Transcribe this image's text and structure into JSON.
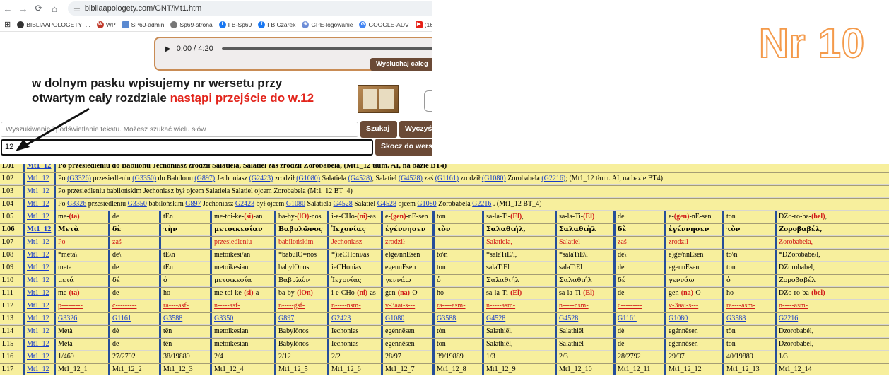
{
  "browser": {
    "url": "bibliaapologety.com/GNT/Mt1.htm",
    "bookmarks": [
      "BIBLIAAPOLOGETY_...",
      "WP",
      "SP69-admin",
      "Sp69-strona",
      "FB-Sp69",
      "FB Czarek",
      "GPE-logowanie",
      "GOOGLE-ADV",
      "(16"
    ]
  },
  "player": {
    "time": "0:00 / 4:20",
    "listen_label": "Wysłuchaj całeg"
  },
  "annotation": {
    "line1": "w dolnym pasku wpisujemy nr wersetu przy",
    "line2": "otwartym cały rozdziale",
    "line2_red": "nastąpi przejście do w.12"
  },
  "search": {
    "placeholder": "Wyszukiwanie i podświetlanie tekstu. Możesz szukać wielu słów",
    "search_label": "Szukaj",
    "clear_label": "Wyczyść",
    "verse_value": "12",
    "goto_label": "Skocz do wersetu"
  },
  "overlay": {
    "label": "Nr 10"
  },
  "table": {
    "L01": {
      "label": "L01",
      "ref": "Mt1_12",
      "text": "Po przesiedleniu do Babilonu Jechoniasz zrodził Salatiela, Salatiel zaś zrodził Zorobabela, (Mt1_12 tłum. AI, na bazie BT4)"
    },
    "L02": {
      "label": "L02",
      "ref": "Mt1_12",
      "parts": [
        "Po ",
        "(G3326)",
        " przesiedleniu ",
        "(G3350)",
        " do Babilonu ",
        "(G897)",
        " Jechoniasz ",
        "(G2423)",
        " zrodził ",
        "(G1080)",
        " Salatiela ",
        "(G4528)",
        ", Salatiel ",
        "(G4528)",
        " zaś ",
        "(G1161)",
        " zrodził ",
        "(G1080)",
        " Zorobabela ",
        "(G2216)",
        "; (Mt1_12 tłum. AI, na bazie BT4)"
      ]
    },
    "L03": {
      "label": "L03",
      "ref": "Mt1_12",
      "text": "Po przesiedleniu babilońskim Jechoniasz był ojcem Salatiela Salatiel ojcem Zorobabela (Mt1_12 BT_4)"
    },
    "L04": {
      "label": "L04",
      "ref": "Mt1_12",
      "parts": [
        "Po ",
        "G3326",
        " przesiedleniu ",
        "G3350",
        " babilońskim ",
        "G897",
        " Jechoniasz ",
        "G2423",
        " był ojcem ",
        "G1080",
        " Salatiela ",
        "G4528",
        " Salatiel ",
        "G4528",
        " ojcem ",
        "G1080",
        " Zorobabela ",
        "G2216",
        " . (Mt1_12 BT_4)"
      ]
    },
    "grid_rows": [
      {
        "label": "L05",
        "ref": "Mt1_12",
        "cells": [
          "me-(ta)",
          "de",
          "tEn",
          "me-toi-ke-(si)-an",
          "ba-by-(lO)-nos",
          "i-e-CHo-(ni)-as",
          "e-(gen)-nE-sen",
          "ton",
          "sa-la-Ti-(El),",
          "sa-la-Ti-(El)",
          "de",
          "e-(gen)-nE-sen",
          "ton",
          "DZo-ro-ba-(bel),"
        ]
      },
      {
        "label": "L06",
        "ref": "Mt1_12",
        "cells": [
          "Μετὰ",
          "δὲ",
          "τὴν",
          "μετοικεσίαν",
          "Βαβυλῶνος",
          "Ἰεχονίας",
          "ἐγέννησεν",
          "τὸν",
          "Σαλαθιήλ,",
          "Σαλαθιὴλ",
          "δὲ",
          "ἐγέννησεν",
          "τὸν",
          "Ζοροβαβέλ,"
        ]
      },
      {
        "label": "L07",
        "ref": "Mt1_12",
        "cells": [
          "Po",
          "zaś",
          "—",
          "przesiedleniu",
          "babilońskim",
          "Jechoniasz",
          "zrodził",
          "—",
          "Salatiela,",
          "Salatiel",
          "zaś",
          "zrodził",
          "—",
          "Zorobabela,"
        ]
      },
      {
        "label": "L08",
        "ref": "Mt1_12",
        "cells": [
          "*meta\\",
          "de\\",
          "tE\\n",
          "metoikesi/an",
          "*babulO=nos",
          "*)ieCHoni/as",
          "e)ge/nnEsen",
          "to\\n",
          "*salaTiE/l,",
          "*salaTiE\\l",
          "de\\",
          "e)ge/nnEsen",
          "to\\n",
          "*DZorobabe/l,"
        ]
      },
      {
        "label": "L09",
        "ref": "Mt1_12",
        "cells": [
          "meta",
          "de",
          "tEn",
          "metoikesian",
          "babylOnos",
          "ieCHonias",
          "egennEsen",
          "ton",
          "salaTiEl",
          "salaTiEl",
          "de",
          "egennEsen",
          "ton",
          "DZorobabel,"
        ]
      },
      {
        "label": "L10",
        "ref": "Mt1_12",
        "cells": [
          "μετά",
          "δέ",
          "ὁ",
          "μετοικεσία",
          "Βαβυλών",
          "Ἰεχονίας",
          "γεννάω",
          "ὁ",
          "Σαλαθιήλ",
          "Σαλαθιήλ",
          "δέ",
          "γεννάω",
          "ὁ",
          "Ζοροβαβέλ"
        ]
      },
      {
        "label": "L11",
        "ref": "Mt1_12",
        "cells": [
          "me-(ta)",
          "de",
          "ho",
          "me-toi-ke-(si)-a",
          "ba-by-(lOn)",
          "i-e-CHo-(ni)-as",
          "gen-(na)-O",
          "ho",
          "sa-la-Ti-(El)",
          "sa-la-Ti-(El)",
          "de",
          "gen-(na)-O",
          "ho",
          "DZo-ro-ba-(bel)"
        ]
      },
      {
        "label": "L12",
        "ref": "Mt1_12",
        "cells": [
          "p---------",
          "c---------",
          "ra----asf-",
          "n-----asf-",
          "n-----gsf-",
          "n-----nsm-",
          "v-3aai-s---",
          "ra----asm-",
          "n-----asm-",
          "n-----nsm-",
          "c---------",
          "v-3aai-s---",
          "ra----asm-",
          "n-----asm-"
        ]
      },
      {
        "label": "L13",
        "ref": "Mt1_12",
        "cells": [
          "G3326",
          "G1161",
          "G3588",
          "G3350",
          "G897",
          "G2423",
          "G1080",
          "G3588",
          "G4528",
          "G4528",
          "G1161",
          "G1080",
          "G3588",
          "G2216"
        ]
      },
      {
        "label": "L14",
        "ref": "Mt1_12",
        "cells": [
          "Metà",
          "dè",
          "tēn",
          "metoikesian",
          "Babylōnos",
          "Iechonias",
          "egénnēsen",
          "tòn",
          "Salathiēl,",
          "Salathiēl",
          "dè",
          "egénnēsen",
          "tòn",
          "Dzorobabél,"
        ]
      },
      {
        "label": "L15",
        "ref": "Mt1_12",
        "cells": [
          "Meta",
          "de",
          "tēn",
          "metoikesian",
          "Babylōnos",
          "Iechonias",
          "egennēsen",
          "ton",
          "Salathiēl,",
          "Salathiēl",
          "de",
          "egennēsen",
          "ton",
          "Dzorobabel,"
        ]
      },
      {
        "label": "L16",
        "ref": "Mt1_12",
        "cells": [
          "1/469",
          "27/2792",
          "38/19889",
          "2/4",
          "2/12",
          "2/2",
          "28/97",
          "39/19889",
          "1/3",
          "2/3",
          "28/2792",
          "29/97",
          "40/19889",
          "1/3"
        ]
      },
      {
        "label": "L17",
        "ref": "Mt1_12",
        "cells": [
          "Mt1_12_1",
          "Mt1_12_2",
          "Mt1_12_3",
          "Mt1_12_4",
          "Mt1_12_5",
          "Mt1_12_6",
          "Mt1_12_7",
          "Mt1_12_8",
          "Mt1_12_9",
          "Mt1_12_10",
          "Mt1_12_11",
          "Mt1_12_12",
          "Mt1_12_13",
          "Mt1_12_14"
        ]
      }
    ]
  }
}
